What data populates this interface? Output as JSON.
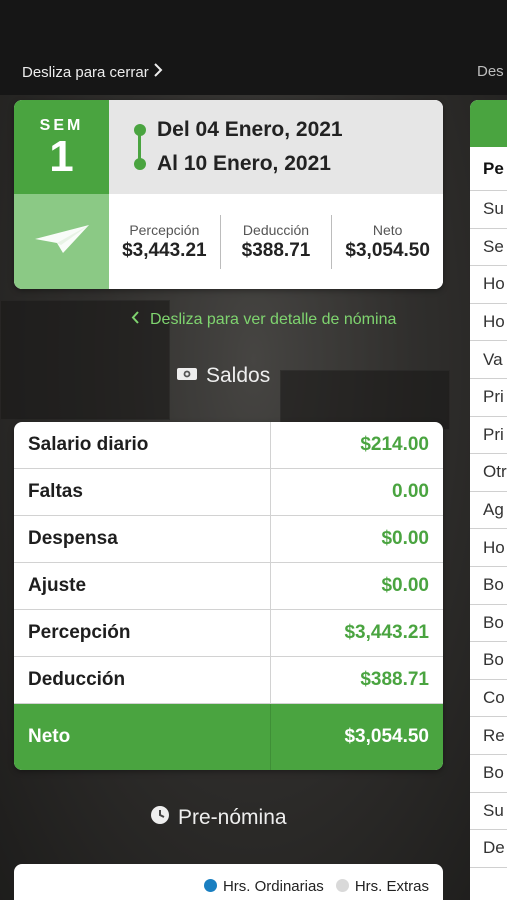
{
  "header": {
    "swipe_close": "Desliza para cerrar",
    "next_hint": "Des"
  },
  "week": {
    "label": "SEM",
    "number": "1",
    "date_from": "Del 04 Enero, 2021",
    "date_to": "Al 10 Enero, 2021",
    "totals": [
      {
        "label": "Percepción",
        "value": "$3,443.21"
      },
      {
        "label": "Deducción",
        "value": "$388.71"
      },
      {
        "label": "Neto",
        "value": "$3,054.50"
      }
    ]
  },
  "detail_hint": "Desliza para ver detalle de nómina",
  "balances": {
    "title": "Saldos",
    "rows": [
      {
        "label": "Salario diario",
        "value": "$214.00"
      },
      {
        "label": "Faltas",
        "value": "0.00"
      },
      {
        "label": "Despensa",
        "value": "$0.00"
      },
      {
        "label": "Ajuste",
        "value": "$0.00"
      },
      {
        "label": "Percepción",
        "value": "$3,443.21"
      },
      {
        "label": "Deducción",
        "value": "$388.71"
      }
    ],
    "net": {
      "label": "Neto",
      "value": "$3,054.50"
    }
  },
  "prenomina": {
    "title": "Pre-nómina",
    "legend": [
      {
        "label": "Hrs. Ordinarias",
        "color": "#1a7fc1"
      },
      {
        "label": "Hrs. Extras",
        "color": "#d9d9d9"
      }
    ]
  },
  "peek": {
    "header": "Pe",
    "rows": [
      "Su",
      "Se",
      "Ho",
      "Ho",
      "Va",
      "Pri",
      "Pri",
      "Otr",
      "Ag",
      "Ho",
      "Bo",
      "Bo",
      "Bo",
      "Co",
      "Re",
      "Bo",
      "Su Se",
      "De"
    ]
  },
  "colors": {
    "accent": "#4aa440",
    "accent_light": "#8bc985"
  }
}
